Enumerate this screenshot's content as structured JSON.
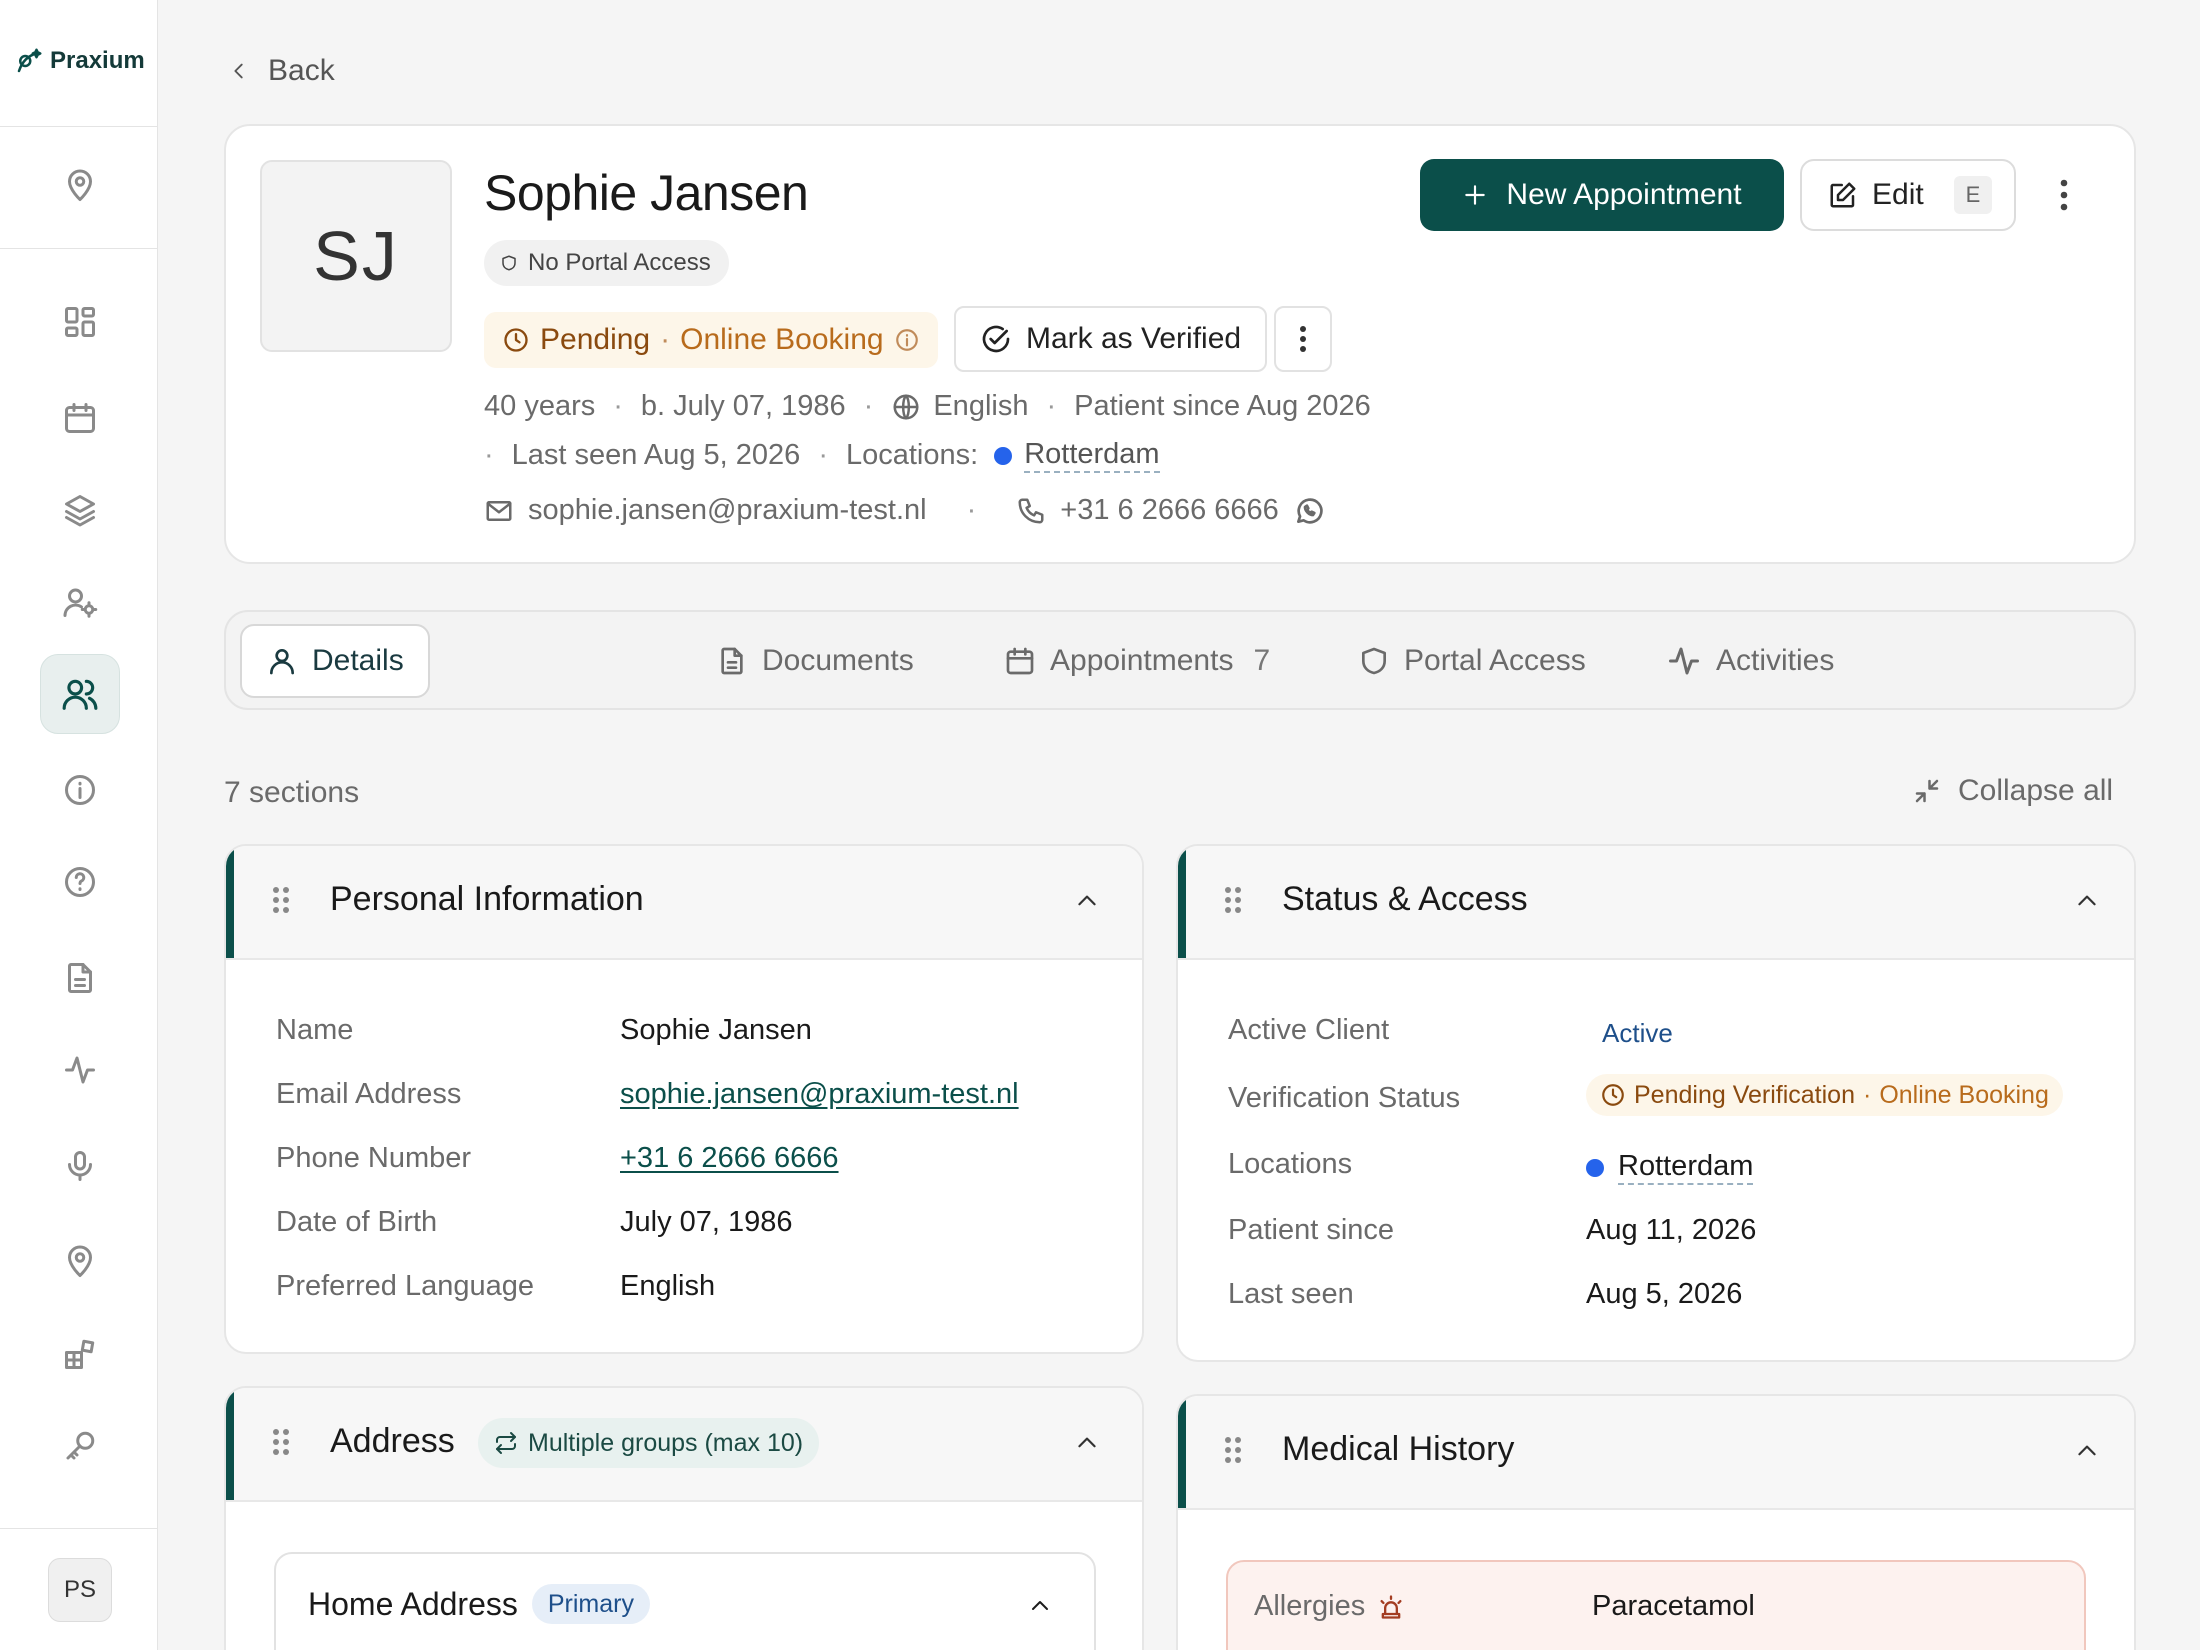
{
  "app": {
    "name": "Praxium"
  },
  "user": {
    "initials": "PS"
  },
  "nav": {
    "back": "Back"
  },
  "patient": {
    "initials": "SJ",
    "name": "Sophie Jansen",
    "portal_badge": "No Portal Access",
    "status": "Pending",
    "status_source": "Online Booking",
    "age": "40 years",
    "born": "b. July 07, 1986",
    "language": "English",
    "since": "Patient since Aug 2026",
    "last_seen": "Last seen Aug 5, 2026",
    "locations_label": "Locations:",
    "location": "Rotterdam",
    "email": "sophie.jansen@praxium-test.nl",
    "phone": "+31 6 2666 6666"
  },
  "actions": {
    "mark_verified": "Mark as Verified",
    "new_appointment": "New Appointment",
    "edit": "Edit",
    "edit_shortcut": "E"
  },
  "tabs": [
    {
      "label": "Details"
    },
    {
      "label": "Documents"
    },
    {
      "label": "Appointments",
      "count": "7"
    },
    {
      "label": "Portal Access"
    },
    {
      "label": "Activities"
    }
  ],
  "sections": {
    "count_label": "7 sections",
    "collapse_all": "Collapse all",
    "personal": {
      "title": "Personal Information",
      "rows": [
        {
          "label": "Name",
          "value": "Sophie Jansen"
        },
        {
          "label": "Email Address",
          "value": "sophie.jansen@praxium-test.nl"
        },
        {
          "label": "Phone Number",
          "value": "+31 6 2666 6666"
        },
        {
          "label": "Date of Birth",
          "value": "July 07, 1986"
        },
        {
          "label": "Preferred Language",
          "value": "English"
        }
      ]
    },
    "status": {
      "title": "Status & Access",
      "rows": [
        {
          "label": "Active Client",
          "value": "Active"
        },
        {
          "label": "Verification Status",
          "value": "Pending Verification",
          "sub": "Online Booking"
        },
        {
          "label": "Locations",
          "value": "Rotterdam"
        },
        {
          "label": "Patient since",
          "value": "Aug 11, 2026"
        },
        {
          "label": "Last seen",
          "value": "Aug 5, 2026"
        }
      ]
    },
    "address": {
      "title": "Address",
      "badge": "Multiple groups (max 10)",
      "home": {
        "title": "Home Address",
        "badge": "Primary"
      }
    },
    "medical": {
      "title": "Medical History",
      "allergies_label": "Allergies",
      "allergies_value": "Paracetamol"
    }
  },
  "colors": {
    "brand": "#0b4f4a",
    "pending": "#b86b1c",
    "location_dot": "#2563eb"
  }
}
